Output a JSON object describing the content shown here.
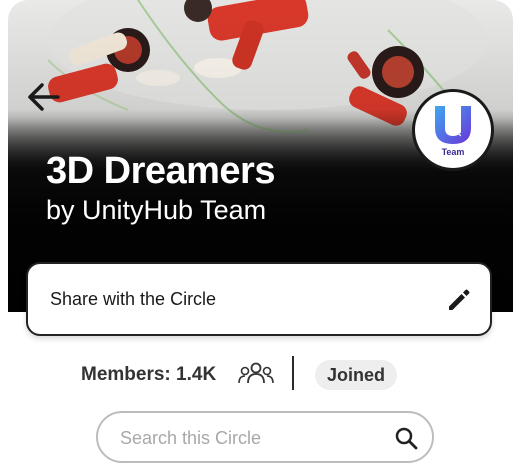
{
  "circle": {
    "title": "3D Dreamers",
    "subtitle": "by UnityHub Team",
    "logo_text": "Team"
  },
  "share": {
    "label": "Share with the Circle",
    "edit_icon": "pencil-icon"
  },
  "meta": {
    "members_label": "Members: 1.4K",
    "members_icon": "group-icon",
    "status": "Joined"
  },
  "search": {
    "placeholder": "Search this Circle",
    "icon": "search-icon"
  },
  "nav": {
    "back_icon": "arrow-left-icon"
  },
  "colors": {
    "hero_dark": "#0f0f0f",
    "logo_accent": "#5b3fd8",
    "text_dark": "#333333",
    "chip_bg": "#eeeeee"
  }
}
